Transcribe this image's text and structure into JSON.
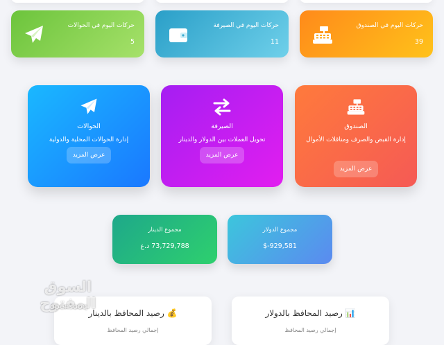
{
  "stats": [
    {
      "title": "حركات اليوم في الصندوق",
      "value": "39",
      "icon": "cash-register-icon"
    },
    {
      "title": "حركات اليوم في الصيرفة",
      "value": "11",
      "icon": "wallet-icon"
    },
    {
      "title": "حركات اليوم في الحوالات",
      "value": "5",
      "icon": "paper-plane-icon"
    }
  ],
  "services": [
    {
      "name": "الصندوق",
      "description": "إدارة القبض والصرف ومناقلات الأموال",
      "button": "عرض المزيد",
      "icon": "cash-register-icon"
    },
    {
      "name": "الصيرفة",
      "description": "تحويل العملات بين الدولار والدينار",
      "button": "عرض المزيد",
      "icon": "exchange-arrows-icon"
    },
    {
      "name": "الحوالات",
      "description": "إدارة الحوالات المحلية والدولية",
      "button": "عرض المزيد",
      "icon": "paper-plane-icon"
    }
  ],
  "totals": {
    "dollar": {
      "label": "مجموع الدولار",
      "amount": "929,581-$"
    },
    "dinar": {
      "label": "مجموع الدينار",
      "amount": "73,729,788 د.ع"
    }
  },
  "wallets": {
    "dollar": {
      "title": "📊 رصيد المحافظ بالدولار",
      "sub": "إجمالي رصيد المحافظ"
    },
    "dinar": {
      "title": "💰 رصيد المحافظ بالدينار",
      "sub": "إجمالي رصيد المحافظ"
    }
  },
  "watermark": {
    "arabic": "السوق المفتوح",
    "english": "opensooq"
  },
  "colors": {
    "orange": "#ff9a12",
    "teal": "#3fb3d6",
    "green": "#7ccd4d",
    "red_orange": "#fa6b4a",
    "purple": "#c318f0",
    "blue": "#1da4ff",
    "emerald": "#22bd7e",
    "cyan_blue": "#4a93e8"
  }
}
